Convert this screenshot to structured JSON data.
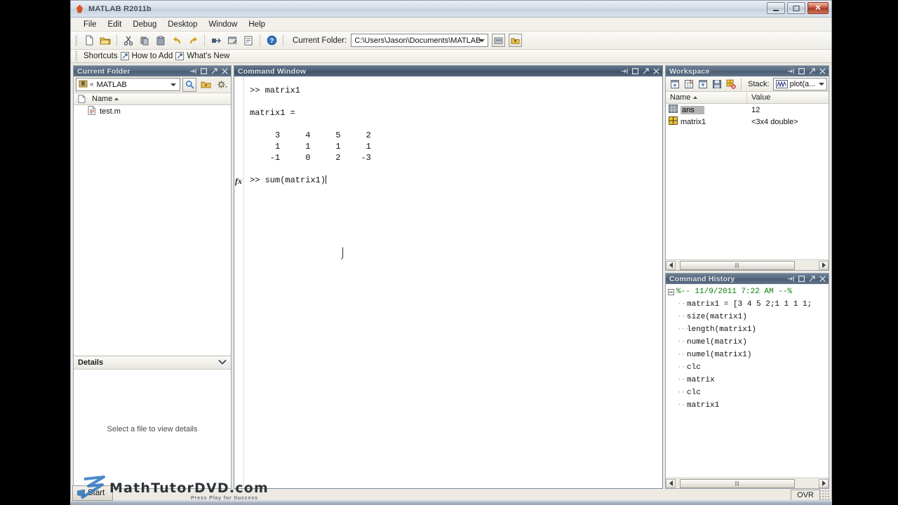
{
  "window": {
    "title": "MATLAB R2011b",
    "app_icon": "matlab-icon",
    "controls": {
      "minimize": "minimize-button",
      "maximize": "maximize-button",
      "close": "✕"
    }
  },
  "menubar": {
    "items": [
      {
        "label": "File"
      },
      {
        "label": "Edit"
      },
      {
        "label": "Debug"
      },
      {
        "label": "Desktop"
      },
      {
        "label": "Window"
      },
      {
        "label": "Help"
      }
    ]
  },
  "toolbar": {
    "buttons": [
      {
        "name": "new-script-icon",
        "tip": "New Script"
      },
      {
        "name": "open-file-icon",
        "tip": "Open File"
      },
      {
        "name": "cut-icon",
        "tip": "Cut"
      },
      {
        "name": "copy-icon",
        "tip": "Copy"
      },
      {
        "name": "paste-icon",
        "tip": "Paste"
      },
      {
        "name": "undo-icon",
        "tip": "Undo"
      },
      {
        "name": "redo-icon",
        "tip": "Redo"
      },
      {
        "name": "simulink-icon",
        "tip": "Simulink Library"
      },
      {
        "name": "guide-icon",
        "tip": "GUIDE"
      },
      {
        "name": "profiler-icon",
        "tip": "Profiler"
      },
      {
        "name": "help-icon",
        "tip": "Help"
      }
    ],
    "current_folder_label": "Current Folder:",
    "current_folder_value": "C:\\Users\\Jason\\Documents\\MATLAB",
    "browse_button": "browse-folder-button",
    "up_button": "up-one-level-button"
  },
  "shortcuts_bar": {
    "label": "Shortcuts",
    "items": [
      {
        "label": "How to Add"
      },
      {
        "label": "What's New"
      }
    ]
  },
  "current_folder_panel": {
    "title": "Current Folder",
    "path": "MATLAB",
    "path_prefix": "«",
    "search_button": "search-button",
    "new-folder_button": "new-folder-button",
    "actions_button": "actions-gear-button",
    "columns": [
      "Name"
    ],
    "files": [
      {
        "name": "test.m",
        "icon": "m-file-icon"
      }
    ],
    "details": {
      "title": "Details",
      "empty_text": "Select a file to view details"
    }
  },
  "command_window": {
    "title": "Command Window",
    "lines": [
      ">> matrix1",
      "",
      "matrix1 =",
      "",
      "     3     4     5     2",
      "     1     1     1     1",
      "    -1     0     2    -3",
      "",
      ">> sum(matrix1)"
    ],
    "prompt": ">>",
    "current_input": "sum(matrix1)",
    "fx_glyph": "fx"
  },
  "workspace": {
    "title": "Workspace",
    "toolbar": [
      {
        "name": "new-variable-icon"
      },
      {
        "name": "open-variable-icon"
      },
      {
        "name": "import-data-icon"
      },
      {
        "name": "save-workspace-icon"
      },
      {
        "name": "delete-variable-icon"
      }
    ],
    "stack_label": "Stack:",
    "plot_selector": "plot(a...",
    "columns": [
      "Name",
      "Value"
    ],
    "rows": [
      {
        "name": "ans",
        "value": "12",
        "icon": "array-icon",
        "selected": true
      },
      {
        "name": "matrix1",
        "value": "<3x4 double>",
        "icon": "matrix-icon",
        "selected": false
      }
    ]
  },
  "command_history": {
    "title": "Command History",
    "session_header": "%-- 11/9/2011 7:22 AM --%",
    "items": [
      "matrix1 = [3 4 5 2;1 1 1 1;",
      "size(matrix1)",
      "length(matrix1)",
      "numel(matrix)",
      "numel(matrix1)",
      "clc",
      "matrix",
      "clc",
      "matrix1"
    ]
  },
  "statusbar": {
    "overwrite_mode": "OVR"
  },
  "taskbar": {
    "start_label": "Start"
  },
  "watermark": {
    "brand": "MathTutorDVD",
    "domain": ".com",
    "tagline": "Press Play for Success"
  },
  "colors": {
    "panel_title_bg": "#4a5d73",
    "window_bg": "#eceae3",
    "content_bg": "#ffffff",
    "history_date": "#0a7a0a",
    "selection": "#b4b4b4",
    "close_button": "#a33a25"
  }
}
